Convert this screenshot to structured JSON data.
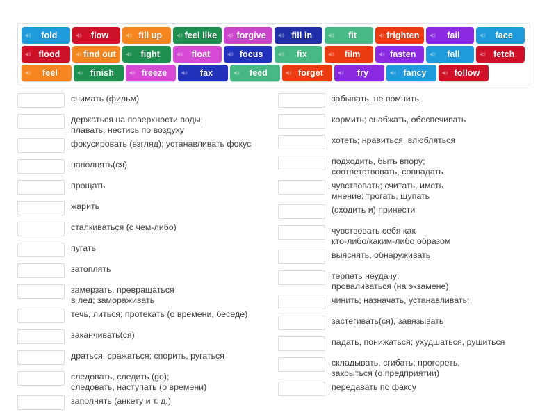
{
  "tile_bank": {
    "speaker_icon": "speaker-icon",
    "rows": [
      [
        {
          "word": "fold",
          "color": "#1f9bdd"
        },
        {
          "word": "flow",
          "color": "#cf1128"
        },
        {
          "word": "fill up",
          "color": "#f5861f"
        },
        {
          "word": "feel like",
          "color": "#1d8f4e"
        },
        {
          "word": "forgive",
          "color": "#cc44cc"
        },
        {
          "word": "fill in",
          "color": "#1e2fa8"
        },
        {
          "word": "fit",
          "color": "#46b883"
        },
        {
          "word": "frighten",
          "color": "#ec3b11"
        },
        {
          "word": "fail",
          "color": "#8a2be2"
        },
        {
          "word": "face",
          "color": "#1f9bdd"
        }
      ],
      [
        {
          "word": "flood",
          "color": "#cf1128"
        },
        {
          "word": "find out",
          "color": "#f5861f"
        },
        {
          "word": "fight",
          "color": "#1d8f4e"
        },
        {
          "word": "float",
          "color": "#d64ad6"
        },
        {
          "word": "focus",
          "color": "#2233bb"
        },
        {
          "word": "fix",
          "color": "#46b883"
        },
        {
          "word": "film",
          "color": "#ec3b11"
        },
        {
          "word": "fasten",
          "color": "#8a2be2"
        },
        {
          "word": "fall",
          "color": "#1f9bdd"
        },
        {
          "word": "fetch",
          "color": "#cf1128"
        }
      ],
      [
        {
          "word": "feel",
          "color": "#f5861f"
        },
        {
          "word": "finish",
          "color": "#1d8f4e"
        },
        {
          "word": "freeze",
          "color": "#d64ad6"
        },
        {
          "word": "fax",
          "color": "#2233bb"
        },
        {
          "word": "feed",
          "color": "#46b883"
        },
        {
          "word": "forget",
          "color": "#ec3b11"
        },
        {
          "word": "fry",
          "color": "#8a2be2"
        },
        {
          "word": "fancy",
          "color": "#1f9bdd"
        },
        {
          "word": "follow",
          "color": "#cf1128"
        }
      ]
    ]
  },
  "answers": {
    "left_column": [
      {
        "box_value": "",
        "text": "снимать (фильм)"
      },
      {
        "box_value": "",
        "text": "держаться на поверхности воды,\nплавать; нестись по воздуху"
      },
      {
        "box_value": "",
        "text": "фокусировать (взгляд); устанавливать фокус"
      },
      {
        "box_value": "",
        "text": "наполнять(ся)"
      },
      {
        "box_value": "",
        "text": "прощать"
      },
      {
        "box_value": "",
        "text": "жарить"
      },
      {
        "box_value": "",
        "text": "сталкиваться (с чем-либо)"
      },
      {
        "box_value": "",
        "text": "пугать"
      },
      {
        "box_value": "",
        "text": "затоплять"
      },
      {
        "box_value": "",
        "text": "замерзать, превращаться\nв лед; замораживать"
      },
      {
        "box_value": "",
        "text": "течь, литься; протекать (о времени, беседе)"
      },
      {
        "box_value": "",
        "text": "заканчивать(ся)"
      },
      {
        "box_value": "",
        "text": "драться, сражаться; спорить, ругаться"
      },
      {
        "box_value": "",
        "text": "следовать, следить (go);\nследовать, наступать (о времени)"
      },
      {
        "box_value": "",
        "text": "заполнять (анкету и т. д.)"
      }
    ],
    "right_column": [
      {
        "box_value": "",
        "text": "забывать, не помнить"
      },
      {
        "box_value": "",
        "text": "кормить; снабжать, обеспечивать"
      },
      {
        "box_value": "",
        "text": "хотеть; нравиться, влюбляться"
      },
      {
        "box_value": "",
        "text": "подходить, быть впору;\nсоответствовать, совпадать"
      },
      {
        "box_value": "",
        "text": "чувствовать; считать, иметь\nмнение; трогать, щупать"
      },
      {
        "box_value": "",
        "text": "(сходить и) принести"
      },
      {
        "box_value": "",
        "text": "чувствовать себя как\nкто-либо/каким-либо образом"
      },
      {
        "box_value": "",
        "text": "выяснять, обнаруживать"
      },
      {
        "box_value": "",
        "text": "терпеть неудачу;\nпроваливаться (на экзамене)"
      },
      {
        "box_value": "",
        "text": "чинить; назначать, устанавливать;"
      },
      {
        "box_value": "",
        "text": "застегивать(ся), завязывать"
      },
      {
        "box_value": "",
        "text": "падать, понижаться; ухудшаться, рушиться"
      },
      {
        "box_value": "",
        "text": "складывать, сгибать; прогореть,\nзакрыться (о предприятии)"
      },
      {
        "box_value": "",
        "text": "передавать по факсу"
      }
    ]
  }
}
